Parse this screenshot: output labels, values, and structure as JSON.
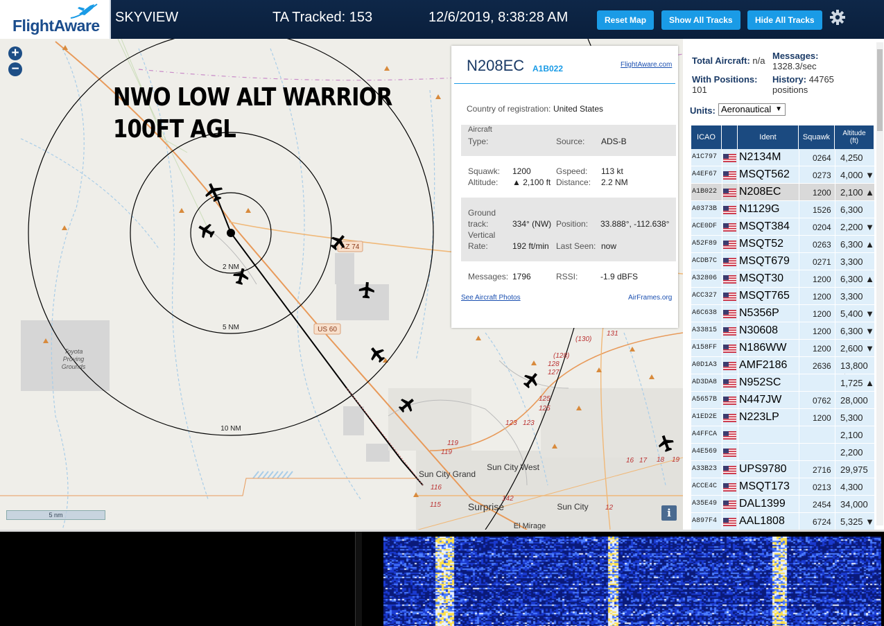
{
  "header": {
    "logo_text": "FlightAware",
    "app_name": "SKYVIEW",
    "tracked_label": "TA Tracked: 153",
    "datetime": "12/6/2019, 8:38:28 AM",
    "reset_map": "Reset Map",
    "show_all_tracks": "Show All Tracks",
    "hide_all_tracks": "Hide All Tracks",
    "settings_icon": "gear-icon"
  },
  "map": {
    "overlay_line1": "NWO LOW ALT WARRIOR",
    "overlay_line2": "100FT AGL",
    "ring_labels": [
      "2 NM",
      "5 NM",
      "10 NM"
    ],
    "places": [
      "Toyota",
      "Proving",
      "Grounds",
      "Sun City Grand",
      "Sun City West",
      "Surprise",
      "Sun City",
      "El Mirage"
    ],
    "road_shields": [
      "AZ 74",
      "US 60"
    ],
    "road_numbers": [
      "(130)",
      "131",
      "(128)",
      "128",
      "127",
      "125",
      "125",
      "123",
      "123",
      "119",
      "119",
      "116",
      "115",
      "142",
      "12",
      "17",
      "16",
      "18",
      "19"
    ],
    "scale_label": "5 nm",
    "info_icon": "i",
    "zoom_in": "+",
    "zoom_out": "−"
  },
  "aircraft_info": {
    "callsign": "N208EC",
    "hex": "A1B022",
    "flightaware_link": "FlightAware.com",
    "country_label": "Country of registration:",
    "country_value": "United States",
    "aircraft_type_label1": "Aircraft",
    "aircraft_type_label2": "Type:",
    "source_label": "Source:",
    "source_value": "ADS-B",
    "squawk_label": "Squawk:",
    "squawk_value": "1200",
    "gspeed_label": "Gspeed:",
    "gspeed_value": "113 kt",
    "altitude_label": "Altitude:",
    "altitude_value": "▲ 2,100 ft",
    "distance_label": "Distance:",
    "distance_value": "2.2 NM",
    "ground_label1": "Ground",
    "ground_label2": "track:",
    "ground_value": "334° (NW)",
    "position_label": "Position:",
    "position_value": "33.888°, -112.638°",
    "vertical_label1": "Vertical",
    "vertical_label2": "Rate:",
    "vertical_value": "192 ft/min",
    "last_seen_label": "Last Seen:",
    "last_seen_value": "now",
    "messages_label": "Messages:",
    "messages_value": "1796",
    "rssi_label": "RSSI:",
    "rssi_value": "-1.9 dBFS",
    "photos_link": "See Aircraft Photos",
    "airframes_link": "AirFrames.org"
  },
  "panel": {
    "total_aircraft_label": "Total Aircraft:",
    "total_aircraft_value": "n/a",
    "messages_label": "Messages:",
    "messages_value": "1328.3/sec",
    "with_positions_label": "With Positions:",
    "with_positions_value": "101",
    "history_label": "History:",
    "history_value": "44765",
    "history_unit": "positions",
    "units_label": "Units:",
    "units_value": "Aeronautical",
    "columns": [
      "ICAO",
      "",
      "Ident",
      "Squawk",
      "Altitude (ft)"
    ],
    "rows": [
      {
        "icao": "A1C797",
        "ident": "N2134M",
        "squawk": "0264",
        "alt": "4,250"
      },
      {
        "icao": "A4EF67",
        "ident": "MSQT562",
        "squawk": "0273",
        "alt": "4,000 ▼"
      },
      {
        "icao": "A1B022",
        "ident": "N208EC",
        "squawk": "1200",
        "alt": "2,100 ▲"
      },
      {
        "icao": "A0373B",
        "ident": "N1129G",
        "squawk": "1526",
        "alt": "6,300"
      },
      {
        "icao": "ACE0DF",
        "ident": "MSQT384",
        "squawk": "0204",
        "alt": "2,200 ▼"
      },
      {
        "icao": "A52F89",
        "ident": "MSQT52",
        "squawk": "0263",
        "alt": "6,300 ▲"
      },
      {
        "icao": "ACDB7C",
        "ident": "MSQT679",
        "squawk": "0271",
        "alt": "3,300"
      },
      {
        "icao": "A32806",
        "ident": "MSQT30",
        "squawk": "1200",
        "alt": "6,300 ▲"
      },
      {
        "icao": "ACC327",
        "ident": "MSQT765",
        "squawk": "1200",
        "alt": "3,300"
      },
      {
        "icao": "A6C638",
        "ident": "N5356P",
        "squawk": "1200",
        "alt": "5,400 ▼"
      },
      {
        "icao": "A33815",
        "ident": "N30608",
        "squawk": "1200",
        "alt": "6,300 ▼"
      },
      {
        "icao": "A158FF",
        "ident": "N186WW",
        "squawk": "1200",
        "alt": "2,600 ▼"
      },
      {
        "icao": "A0D1A3",
        "ident": "AMF2186",
        "squawk": "2636",
        "alt": "13,800 ▲"
      },
      {
        "icao": "AD3DA8",
        "ident": "N952SC",
        "squawk": "",
        "alt": "1,725 ▲"
      },
      {
        "icao": "A5657B",
        "ident": "N447JW",
        "squawk": "0762",
        "alt": "28,000"
      },
      {
        "icao": "A1ED2E",
        "ident": "N223LP",
        "squawk": "1200",
        "alt": "5,300"
      },
      {
        "icao": "A4FFCA",
        "ident": "",
        "squawk": "",
        "alt": "2,100"
      },
      {
        "icao": "A4E569",
        "ident": "",
        "squawk": "",
        "alt": "2,200"
      },
      {
        "icao": "A33B23",
        "ident": "UPS9780",
        "squawk": "2716",
        "alt": "29,975"
      },
      {
        "icao": "ACCE4C",
        "ident": "MSQT173",
        "squawk": "0213",
        "alt": "4,300"
      },
      {
        "icao": "A35E49",
        "ident": "DAL1399",
        "squawk": "2454",
        "alt": "34,000"
      },
      {
        "icao": "A897F4",
        "ident": "AAL1808",
        "squawk": "6724",
        "alt": "5,325 ▼"
      }
    ],
    "selected_icao": "A1B022"
  },
  "colors": {
    "header_bg": "#0e2748",
    "button_bg": "#1a9be6",
    "table_header_bg": "#1b4a80",
    "table_row_bg": "#dfeffa",
    "selected_row_bg": "#d9d9d9",
    "map_bg": "#efeee9",
    "road_orange": "#e89a5a"
  }
}
